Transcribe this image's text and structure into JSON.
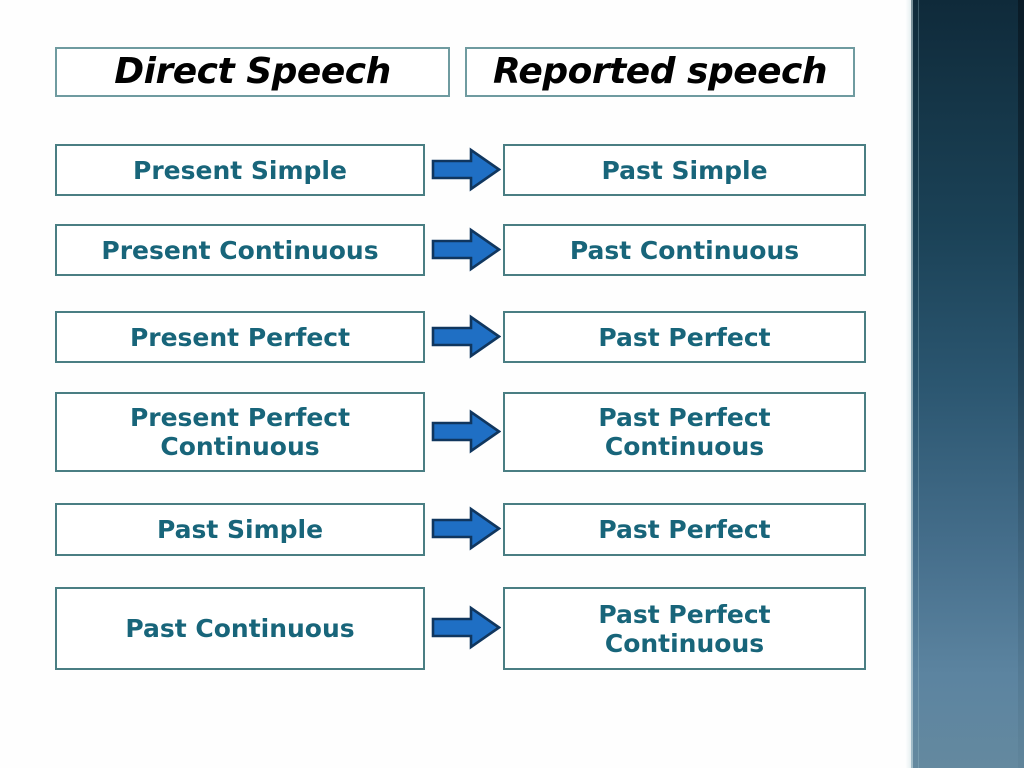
{
  "slide": {
    "background_color": "#fefefe",
    "accent_text_color": "#18657a",
    "box_border_color": "#4a7e83",
    "arrow_fill_color": "#1f6fc4",
    "arrow_outline_color": "#10365e",
    "side_panel_top_color": "#0f2a3a",
    "side_panel_bottom_color": "#64899f"
  },
  "headers": {
    "left": "Direct Speech",
    "right": "Reported speech"
  },
  "rows": [
    {
      "direct": {
        "lines": [
          "Present Simple"
        ]
      },
      "arrow": "right-arrow-icon",
      "reported": {
        "lines": [
          "Past Simple"
        ]
      }
    },
    {
      "direct": {
        "lines": [
          "Present Continuous"
        ]
      },
      "arrow": "right-arrow-icon",
      "reported": {
        "lines": [
          "Past Continuous"
        ]
      }
    },
    {
      "direct": {
        "lines": [
          "Present Perfect"
        ]
      },
      "arrow": "right-arrow-icon",
      "reported": {
        "lines": [
          "Past Perfect"
        ]
      }
    },
    {
      "direct": {
        "lines": [
          "Present Perfect",
          "Continuous"
        ]
      },
      "arrow": "right-arrow-icon",
      "reported": {
        "lines": [
          "Past Perfect",
          "Continuous"
        ]
      }
    },
    {
      "direct": {
        "lines": [
          "Past Simple"
        ]
      },
      "arrow": "right-arrow-icon",
      "reported": {
        "lines": [
          "Past Perfect"
        ]
      }
    },
    {
      "direct": {
        "lines": [
          "Past Continuous"
        ]
      },
      "arrow": "right-arrow-icon",
      "reported": {
        "lines": [
          "Past Perfect",
          "Continuous"
        ]
      }
    }
  ]
}
